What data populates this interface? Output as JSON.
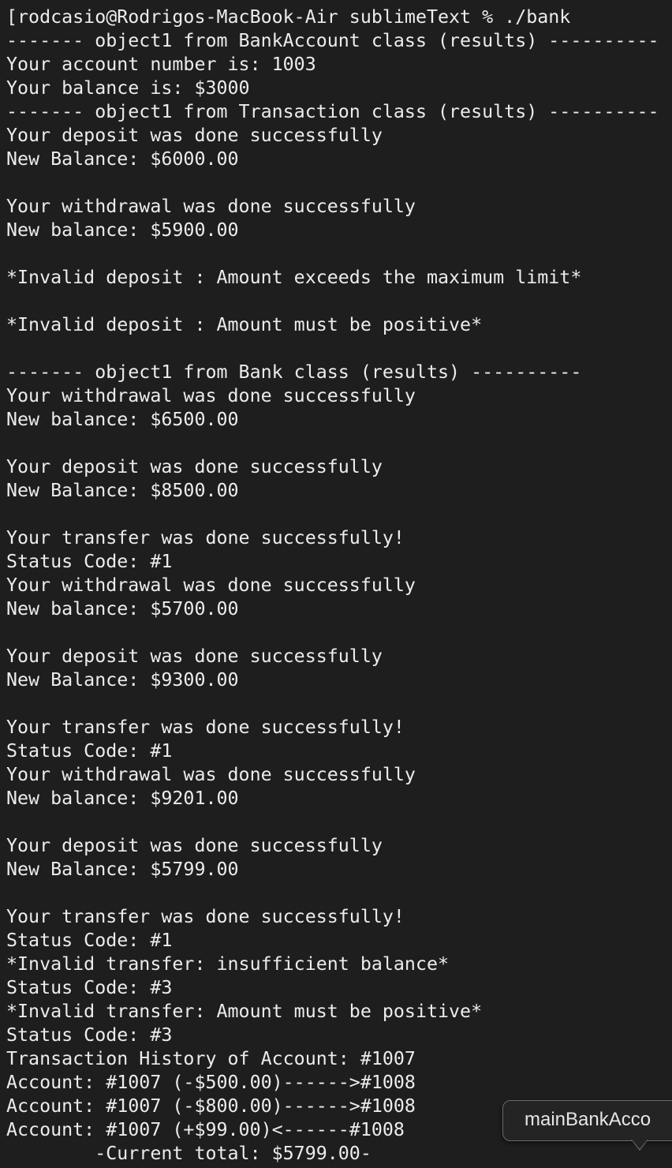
{
  "terminal": {
    "lines": [
      "[rodcasio@Rodrigos-MacBook-Air sublimeText % ./bank",
      "------- object1 from BankAccount class (results) ----------",
      "Your account number is: 1003",
      "Your balance is: $3000",
      "------- object1 from Transaction class (results) ----------",
      "Your deposit was done successfully",
      "New Balance: $6000.00",
      "",
      "Your withdrawal was done successfully",
      "New balance: $5900.00",
      "",
      "*Invalid deposit : Amount exceeds the maximum limit*",
      "",
      "*Invalid deposit : Amount must be positive*",
      "",
      "------- object1 from Bank class (results) ----------",
      "Your withdrawal was done successfully",
      "New balance: $6500.00",
      "",
      "Your deposit was done successfully",
      "New Balance: $8500.00",
      "",
      "Your transfer was done successfully!",
      "Status Code: #1",
      "Your withdrawal was done successfully",
      "New balance: $5700.00",
      "",
      "Your deposit was done successfully",
      "New Balance: $9300.00",
      "",
      "Your transfer was done successfully!",
      "Status Code: #1",
      "Your withdrawal was done successfully",
      "New balance: $9201.00",
      "",
      "Your deposit was done successfully",
      "New Balance: $5799.00",
      "",
      "Your transfer was done successfully!",
      "Status Code: #1",
      "*Invalid transfer: insufficient balance*",
      "Status Code: #3",
      "*Invalid transfer: Amount must be positive*",
      "Status Code: #3",
      "Transaction History of Account: #1007",
      "Account: #1007 (-$500.00)------>#1008",
      "Account: #1007 (-$800.00)------>#1008",
      "Account: #1007 (+$99.00)<------#1008",
      "        -Current total: $5799.00-"
    ]
  },
  "tooltip": {
    "text": "mainBankAcco"
  },
  "colors": {
    "background": "#1e1e1e",
    "text": "#ececec"
  }
}
